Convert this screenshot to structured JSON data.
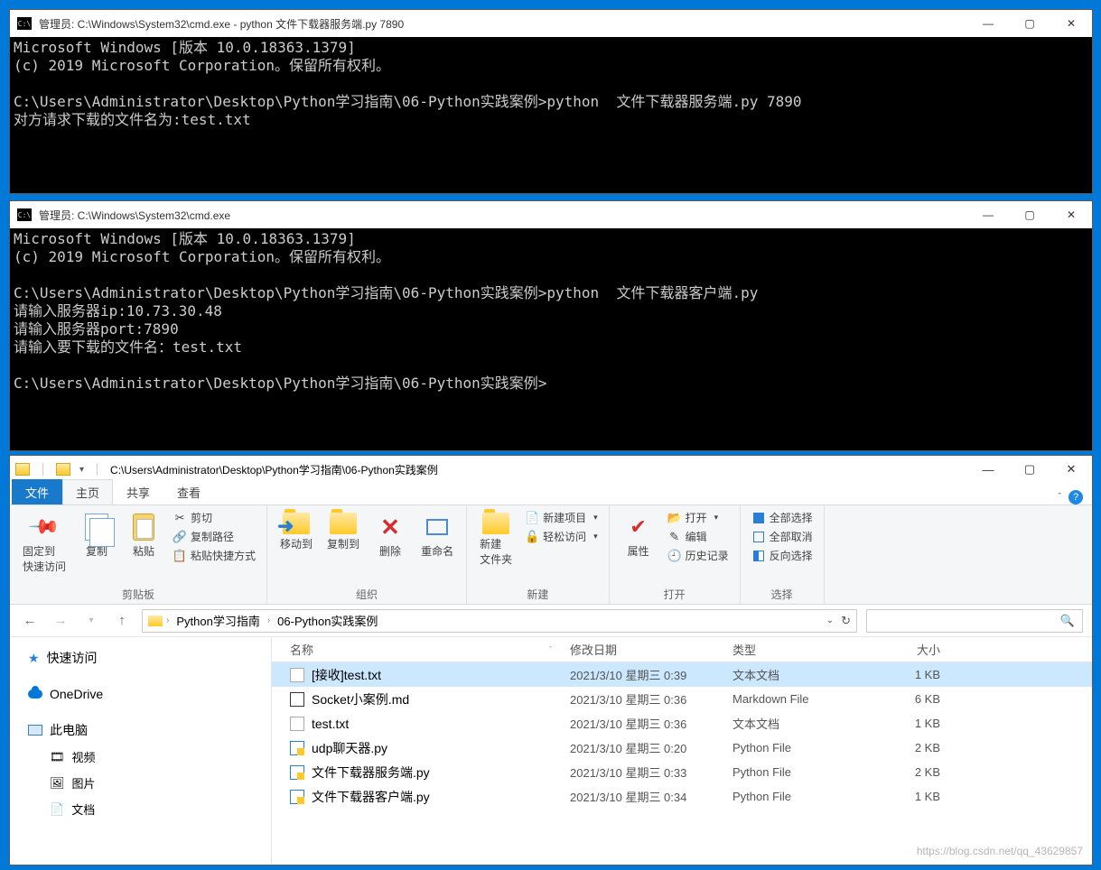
{
  "term1": {
    "title": "管理员: C:\\Windows\\System32\\cmd.exe - python  文件下载器服务端.py 7890",
    "lines": "Microsoft Windows [版本 10.0.18363.1379]\n(c) 2019 Microsoft Corporation。保留所有权利。\n\nC:\\Users\\Administrator\\Desktop\\Python学习指南\\06-Python实践案例>python  文件下载器服务端.py 7890\n对方请求下载的文件名为:test.txt"
  },
  "term2": {
    "title": "管理员: C:\\Windows\\System32\\cmd.exe",
    "lines": "Microsoft Windows [版本 10.0.18363.1379]\n(c) 2019 Microsoft Corporation。保留所有权利。\n\nC:\\Users\\Administrator\\Desktop\\Python学习指南\\06-Python实践案例>python  文件下载器客户端.py\n请输入服务器ip:10.73.30.48\n请输入服务器port:7890\n请输入要下载的文件名：test.txt\n\nC:\\Users\\Administrator\\Desktop\\Python学习指南\\06-Python实践案例>"
  },
  "explorer": {
    "title": "C:\\Users\\Administrator\\Desktop\\Python学习指南\\06-Python实践案例",
    "tabs": {
      "file": "文件",
      "home": "主页",
      "share": "共享",
      "view": "查看"
    },
    "ribbon": {
      "clipboard": {
        "pin": "固定到\n快速访问",
        "copy": "复制",
        "paste": "粘贴",
        "cut": "剪切",
        "copy_path": "复制路径",
        "paste_shortcut": "粘贴快捷方式",
        "label": "剪贴板"
      },
      "organize": {
        "move": "移动到",
        "copy_to": "复制到",
        "delete": "删除",
        "rename": "重命名",
        "label": "组织"
      },
      "new": {
        "new_folder": "新建\n文件夹",
        "new_item": "新建项目",
        "easy_access": "轻松访问",
        "label": "新建"
      },
      "open": {
        "props": "属性",
        "open": "打开",
        "edit": "编辑",
        "history": "历史记录",
        "label": "打开"
      },
      "select": {
        "all": "全部选择",
        "none": "全部取消",
        "invert": "反向选择",
        "label": "选择"
      }
    },
    "crumbs": [
      "Python学习指南",
      "06-Python实践案例"
    ],
    "sidebar": {
      "quick": "快速访问",
      "onedrive": "OneDrive",
      "pc": "此电脑",
      "video": "视频",
      "pictures": "图片",
      "docs": "文档"
    },
    "columns": {
      "name": "名称",
      "date": "修改日期",
      "type": "类型",
      "size": "大小"
    },
    "files": [
      {
        "name": "[接收]test.txt",
        "date": "2021/3/10 星期三 0:39",
        "type": "文本文档",
        "size": "1 KB",
        "icon": "txt",
        "selected": true
      },
      {
        "name": "Socket小案例.md",
        "date": "2021/3/10 星期三 0:36",
        "type": "Markdown File",
        "size": "6 KB",
        "icon": "md"
      },
      {
        "name": "test.txt",
        "date": "2021/3/10 星期三 0:36",
        "type": "文本文档",
        "size": "1 KB",
        "icon": "txt"
      },
      {
        "name": "udp聊天器.py",
        "date": "2021/3/10 星期三 0:20",
        "type": "Python File",
        "size": "2 KB",
        "icon": "py"
      },
      {
        "name": "文件下载器服务端.py",
        "date": "2021/3/10 星期三 0:33",
        "type": "Python File",
        "size": "2 KB",
        "icon": "py"
      },
      {
        "name": "文件下载器客户端.py",
        "date": "2021/3/10 星期三 0:34",
        "type": "Python File",
        "size": "1 KB",
        "icon": "py"
      }
    ]
  },
  "watermark": "https://blog.csdn.net/qq_43629857"
}
